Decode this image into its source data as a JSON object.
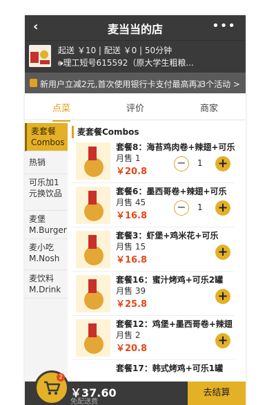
{
  "header": {
    "title": "麦当当的店",
    "back_icon": "chevron-left-icon",
    "more_icon": "more-icon"
  },
  "shop": {
    "delivery_info": "起送 ￥10 | 配送 ￥0 | 50分钟",
    "address": "🕪理工短号615592（原大学生粗粮..."
  },
  "promo": {
    "text": "新用户立减2元,首次使用银行卡支付最高再减3元",
    "count_label": "3个活动 >"
  },
  "tabs": [
    {
      "label": "点菜"
    },
    {
      "label": "评价"
    },
    {
      "label": "商家"
    }
  ],
  "categories": [
    {
      "label": "麦套餐Combos"
    },
    {
      "label": "热销"
    },
    {
      "label": "可乐加1元换饮品"
    },
    {
      "label": "麦堡M.Burger"
    },
    {
      "label": "麦小吃M.Nosh"
    },
    {
      "label": "麦饮料M.Drink"
    }
  ],
  "section_title": "麦套餐Combos",
  "items": [
    {
      "name": "套餐8：海苔鸡肉卷+辣翅+可乐",
      "sales": "月售 1",
      "price": "￥20.8",
      "qty": "1"
    },
    {
      "name": "套餐6：墨西哥卷+辣翅+可乐",
      "sales": "月售 45",
      "price": "￥16.8",
      "qty": "1"
    },
    {
      "name": "套餐3：虾堡+鸡米花+可乐",
      "sales": "月售 15",
      "price": "￥16.8",
      "qty": ""
    },
    {
      "name": "套餐16：蜜汁烤鸡+可乐2罐",
      "sales": "月售 39",
      "price": "￥25.8",
      "qty": ""
    },
    {
      "name": "套餐12：鸡堡+墨西哥卷+辣翅",
      "sales": "月售 2",
      "price": "￥20.8",
      "qty": ""
    },
    {
      "name": "套餐17：韩式烤鸡+可乐1罐",
      "sales": "",
      "price": "",
      "qty": ""
    }
  ],
  "cart": {
    "badge": "2",
    "total": "￥37.60",
    "delivery_note": "免配送费",
    "checkout_label": "去结算"
  },
  "colors": {
    "accent": "#e4b026",
    "price": "#e24a1a",
    "dark": "#3a3a3a"
  }
}
